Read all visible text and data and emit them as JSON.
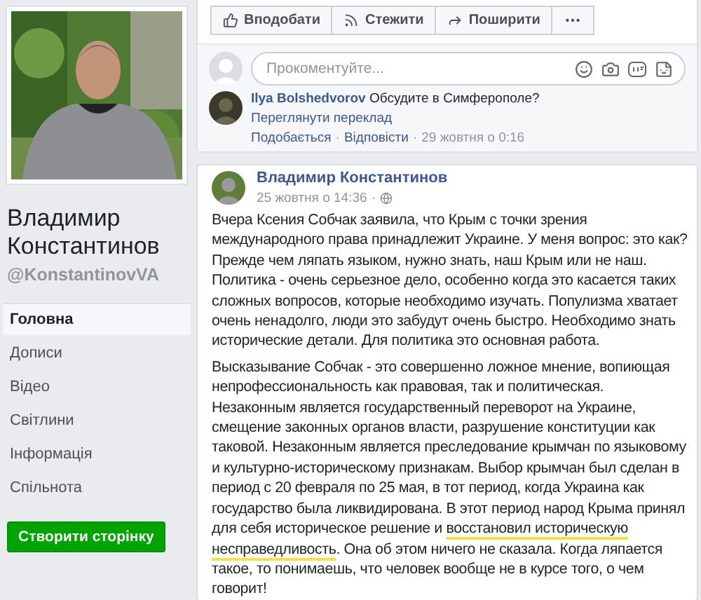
{
  "profile": {
    "name": "Владимир Константинов",
    "handle": "@KonstantinovVA"
  },
  "nav": [
    {
      "label": "Головна",
      "selected": true
    },
    {
      "label": "Дописи",
      "selected": false
    },
    {
      "label": "Відео",
      "selected": false
    },
    {
      "label": "Світлини",
      "selected": false
    },
    {
      "label": "Інформація",
      "selected": false
    },
    {
      "label": "Спільнота",
      "selected": false
    }
  ],
  "create_page_button": "Створити сторінку",
  "actions": [
    {
      "kind": "like",
      "label": "Вподобати"
    },
    {
      "kind": "follow",
      "label": "Стежити"
    },
    {
      "kind": "share",
      "label": "Поширити"
    },
    {
      "kind": "more"
    }
  ],
  "comment_box": {
    "placeholder": "Прокоментуйте..."
  },
  "comment": {
    "author": "Ilya Bolshedvorov",
    "text": "Обсудите в Симферополе?",
    "translate": "Переглянути переклад",
    "meta": [
      {
        "kind": "link",
        "text": "Подобається"
      },
      {
        "kind": "sep",
        "text": "·"
      },
      {
        "kind": "link",
        "text": "Відповісти"
      },
      {
        "kind": "sep",
        "text": "·"
      },
      {
        "kind": "time",
        "text": "29 жовтня о 0:16"
      }
    ]
  },
  "post": {
    "author": "Владимир Константинов",
    "time": "25 жовтня о 14:36",
    "separator": "·",
    "paragraphs": [
      [
        {
          "text": "Вчера Ксения Собчак заявила, что Крым с точки зрения международного права принадлежит Украине. У меня вопрос: это как? Прежде чем ляпать языком, нужно знать, наш Крым или не наш. Политика - очень серьезное дело, особенно когда это касается таких сложных вопросов, которые необходимо изучать. Популизма хватает очень ненадолго, люди это забудут очень быстро. Необходимо знать исторические детали. Для политика это основная работа.",
          "underlined": false
        }
      ],
      [
        {
          "text": "Высказывание Собчак - это совершенно ложное мнение, вопиющая непрофессиональность как правовая, так и политическая. Незаконным является государственный переворот на Украине, смещение законных органов власти, разрушение конституции как таковой. Незаконным является преследование крымчан по языковому и культурно-историческому признакам. Выбор крымчан был сделан в период с 20 февраля по 25 мая, в тот период, когда Украина как государство была ликвидирована. В этот период народ Крыма принял для себя историческое решение и ",
          "underlined": false
        },
        {
          "text": "восстановил историческую несправедливость",
          "underlined": true
        },
        {
          "text": ". Она об этом ничего не сказала. Когда ляпается такое, то понимаешь, что человек вообще не в курсе того, о чем говорит!",
          "underlined": false
        }
      ]
    ]
  }
}
